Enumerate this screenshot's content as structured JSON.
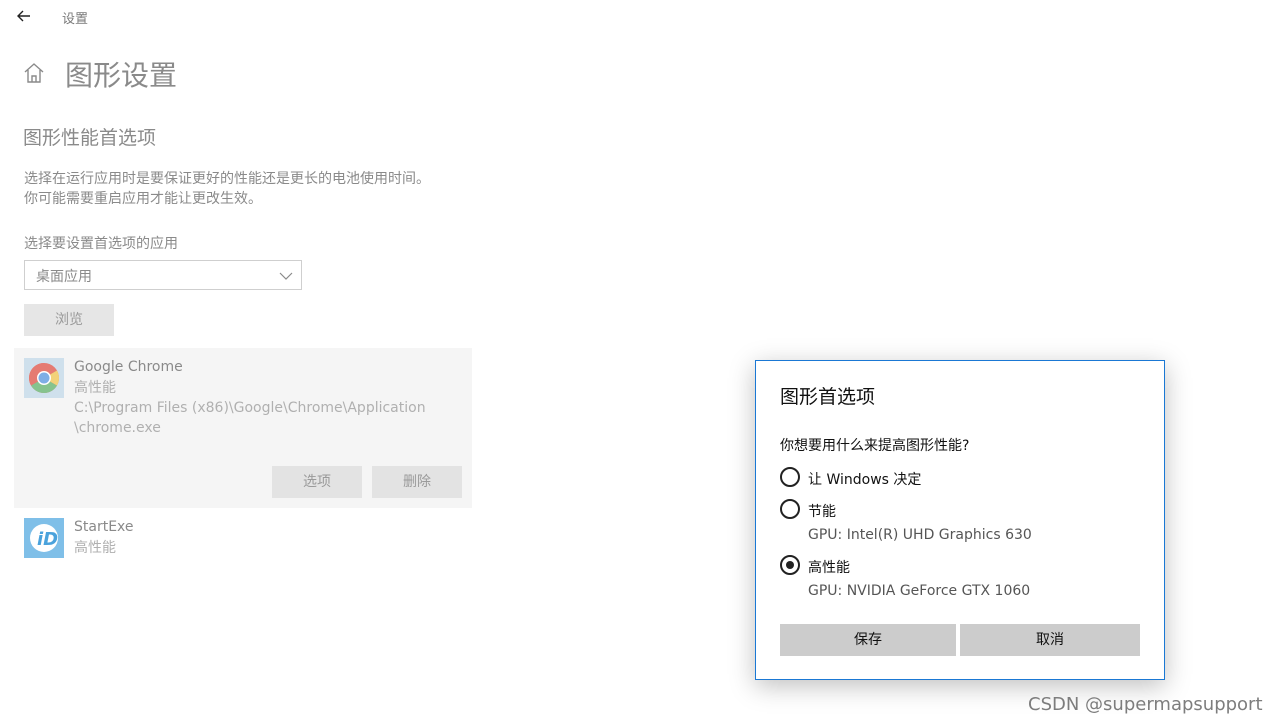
{
  "window": {
    "title": "设置"
  },
  "page": {
    "title": "图形设置",
    "section_title": "图形性能首选项",
    "description": [
      "选择在运行应用时是要保证更好的性能还是更长的电池使用时间。",
      "你可能需要重启应用才能让更改生效。"
    ],
    "select_label": "选择要设置首选项的应用",
    "app_type_selected": "桌面应用",
    "browse_label": "浏览"
  },
  "apps": [
    {
      "name": "Google Chrome",
      "preference": "高性能",
      "path_line1": "C:\\Program Files (x86)\\Google\\Chrome\\Application",
      "path_line2": "\\chrome.exe",
      "options_label": "选项",
      "remove_label": "删除",
      "icon": "chrome-icon"
    },
    {
      "name": "StartExe",
      "preference": "高性能",
      "icon": "startexe-icon"
    }
  ],
  "dialog": {
    "title": "图形首选项",
    "question": "你想要用什么来提高图形性能?",
    "options": [
      {
        "label": "让 Windows 决定",
        "selected": false
      },
      {
        "label": "节能",
        "gpu": "GPU: Intel(R) UHD Graphics 630",
        "selected": false
      },
      {
        "label": "高性能",
        "gpu": "GPU: NVIDIA GeForce GTX 1060",
        "selected": true
      }
    ],
    "save_label": "保存",
    "cancel_label": "取消"
  },
  "watermark": "CSDN @supermapsupport",
  "colors": {
    "dialog_border": "#1a78d4",
    "button_gray": "#cccccc"
  }
}
